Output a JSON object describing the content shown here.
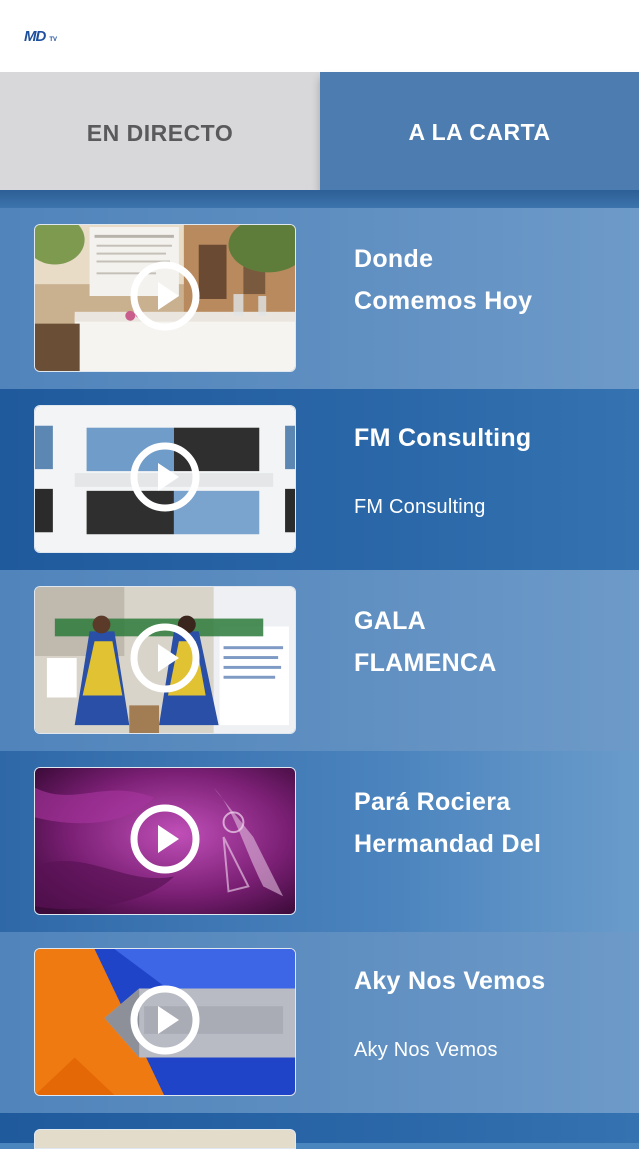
{
  "header": {
    "logo_text": "MD",
    "logo_tv": "TV"
  },
  "tabs": [
    {
      "label": "EN DIRECTO",
      "selected": false
    },
    {
      "label": "A LA CARTA",
      "selected": true
    }
  ],
  "colors": {
    "accent": "#4c7cb0",
    "tab_inactive_bg": "#d8d8da",
    "tab_inactive_text": "#5a5a5c"
  },
  "videos": [
    {
      "title": "Donde\nComemos Hoy",
      "subtitle": "",
      "thumbnail": "restaurant-terrace",
      "icon": "play-icon"
    },
    {
      "title": "FM Consulting",
      "subtitle": "FM Consulting",
      "thumbnail": "fm-consulting-25th-banner",
      "icon": "play-icon"
    },
    {
      "title": "GALA\nFLAMENCA",
      "subtitle": "",
      "thumbnail": "gala-flamenca-solidaria-dancers",
      "icon": "play-icon"
    },
    {
      "title": "Pará Rociera\nHermandad Del",
      "subtitle": "",
      "thumbnail": "purple-flamenco-graphic",
      "icon": "play-icon"
    },
    {
      "title": "Aky Nos Vemos",
      "subtitle": "Aky Nos Vemos",
      "thumbnail": "aky-nos-vemos-title-card",
      "icon": "play-icon"
    }
  ]
}
